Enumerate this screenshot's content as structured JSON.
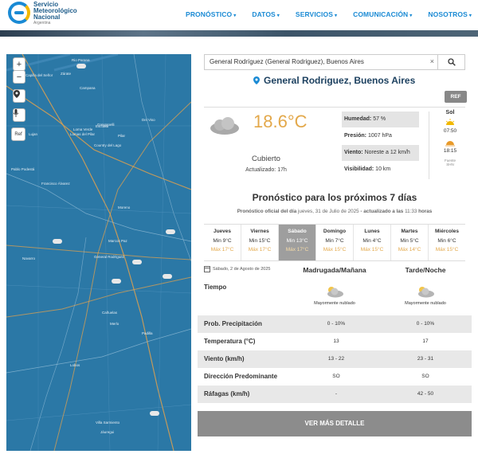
{
  "brand": {
    "name_lines": [
      "Servicio",
      "Meteorológico",
      "Nacional"
    ],
    "country": "Argentina"
  },
  "nav": [
    {
      "label": "PRONÓSTICO",
      "caret": "▾"
    },
    {
      "label": "DATOS",
      "caret": "▾"
    },
    {
      "label": "SERVICIOS",
      "caret": "▾"
    },
    {
      "label": "COMUNICACIÓN",
      "caret": "▾"
    },
    {
      "label": "NOSOTROS",
      "caret": "▾"
    }
  ],
  "map": {
    "zoom_in": "+",
    "zoom_out": "−",
    "ref_label": "Ref",
    "places": [
      "Rio Parana",
      "Zárate",
      "Campana",
      "Capilla del Señor",
      "Pilar",
      "Luján",
      "Escobar",
      "Del Viso",
      "Ganganelli",
      "Loma Verde",
      "Lomas del Pilar",
      "Lujan",
      "Country del Lago",
      "Pablo Podestá",
      "Francisco Álvarez",
      "Moreno",
      "Marcos Paz",
      "General Rodríguez",
      "Navarro",
      "Cañuelas",
      "Merlo",
      "Padilla",
      "Lobos",
      "Villa Sarmiento",
      "Jáuregui"
    ]
  },
  "search": {
    "value": "General Rodríguez (General Rodriguez), Buenos Aires",
    "clear": "×"
  },
  "location": {
    "title": "General Rodriguez, Buenos Aires"
  },
  "ref_button": "REF",
  "current": {
    "temperature": "18.6°C",
    "condition": "Cubierto",
    "updated": "Actualizado: 17h",
    "stats": [
      {
        "label": "Humedad:",
        "value": "57 %"
      },
      {
        "label": "Presión:",
        "value": "1007 hPa"
      },
      {
        "label": "Viento:",
        "value": "Noreste a 12 km/h"
      },
      {
        "label": "Visibilidad:",
        "value": "10 km"
      }
    ],
    "sun": {
      "header": "Sol",
      "sunrise": "07:50",
      "sunset": "18:15",
      "source_lines": [
        "Fuente",
        "SHN"
      ]
    }
  },
  "forecast": {
    "title": "Pronóstico para los próximos 7 días",
    "subtitle_prefix": "Pronóstico oficial del día",
    "subtitle_day": "jueves, 31 de Julio de 2025",
    "subtitle_mid": "- actualizado a las",
    "subtitle_time": "11:33",
    "subtitle_suffix": "horas",
    "days": [
      {
        "name": "Jueves",
        "min": "Min 9°C",
        "max": "Máx 17°C",
        "active": false
      },
      {
        "name": "Viernes",
        "min": "Min 15°C",
        "max": "Máx 17°C",
        "active": false
      },
      {
        "name": "Sábado",
        "min": "Min 13°C",
        "max": "Máx 17°C",
        "active": true
      },
      {
        "name": "Domingo",
        "min": "Min 7°C",
        "max": "Máx 15°C",
        "active": false
      },
      {
        "name": "Lunes",
        "min": "Min 4°C",
        "max": "Máx 15°C",
        "active": false
      },
      {
        "name": "Martes",
        "min": "Min 5°C",
        "max": "Máx 14°C",
        "active": false
      },
      {
        "name": "Miércoles",
        "min": "Min 6°C",
        "max": "Máx 15°C",
        "active": false
      }
    ],
    "detail": {
      "date": "Sábado, 2 de Agosto de 2025",
      "period1": "Madrugada/Mañana",
      "period2": "Tarde/Noche",
      "tiempo_label": "Tiempo",
      "sky1": "Mayormente nublado",
      "sky2": "Mayormente nublado",
      "rows": [
        {
          "label": "Prob. Precipitación",
          "v1": "0 - 10%",
          "v2": "0 - 10%"
        },
        {
          "label": "Temperatura (°C)",
          "v1": "13",
          "v2": "17"
        },
        {
          "label": "Viento (km/h)",
          "v1": "13 - 22",
          "v2": "23 - 31"
        },
        {
          "label": "Dirección Predominante",
          "v1": "SO",
          "v2": "SO"
        },
        {
          "label": "Ráfagas (km/h)",
          "v1": "-",
          "v2": "42 - 50"
        }
      ]
    },
    "more_button": "VER MÁS DETALLE"
  }
}
